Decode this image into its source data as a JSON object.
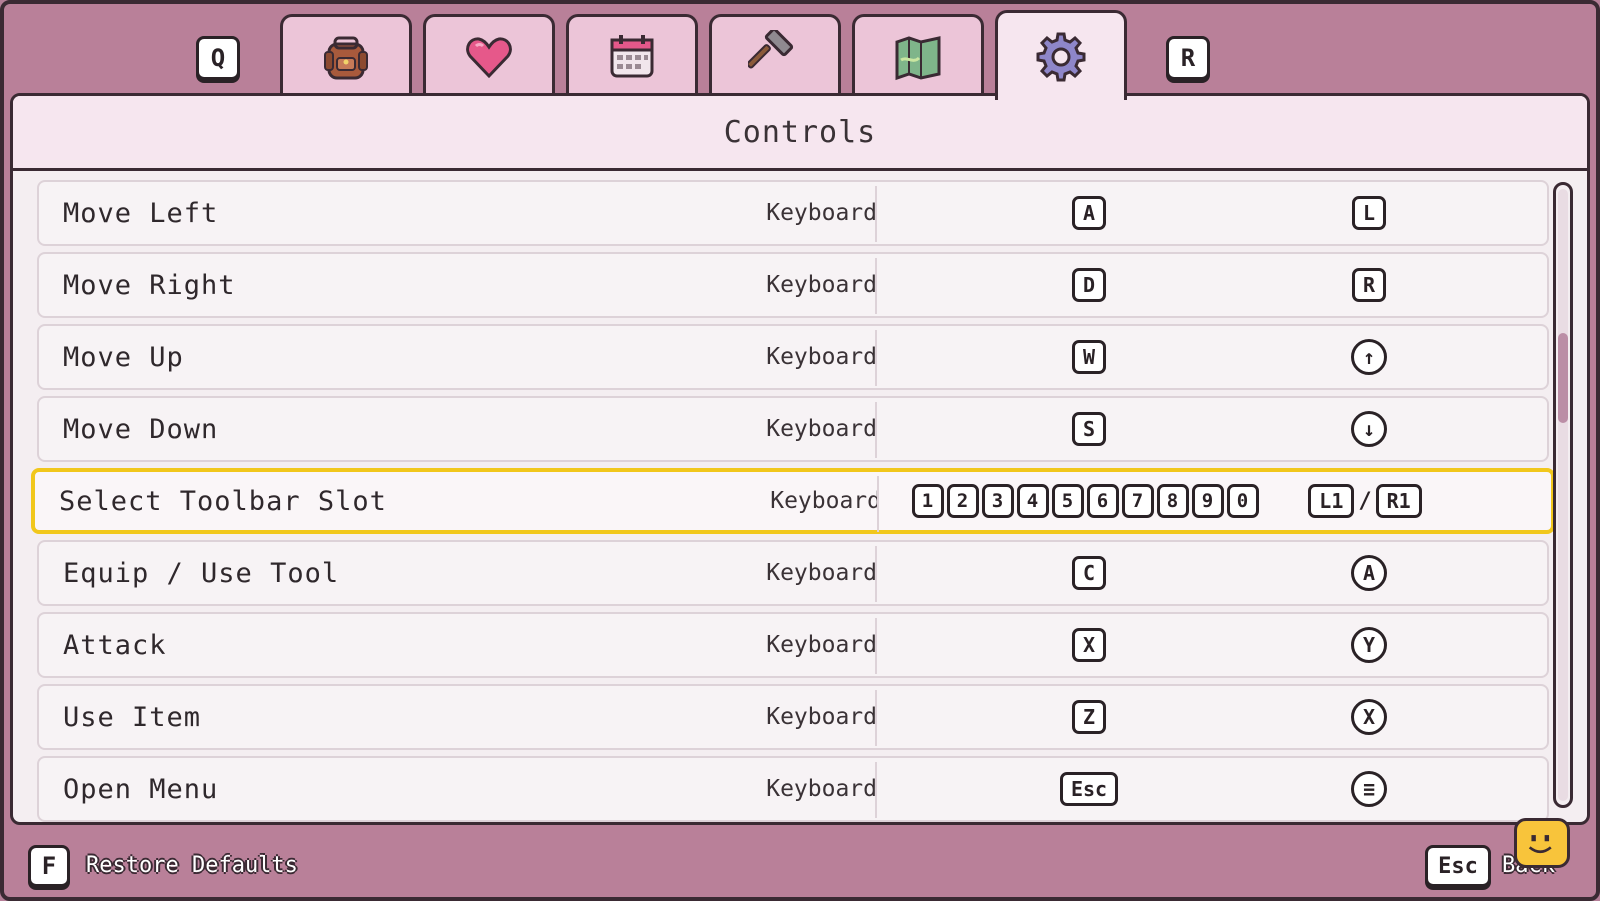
{
  "tabs": {
    "prev_key": "Q",
    "next_key": "R",
    "items": [
      {
        "icon": "backpack-icon"
      },
      {
        "icon": "heart-icon"
      },
      {
        "icon": "calendar-icon"
      },
      {
        "icon": "hammer-icon"
      },
      {
        "icon": "map-icon"
      },
      {
        "icon": "gear-icon",
        "active": true
      }
    ]
  },
  "panel": {
    "title": "Controls"
  },
  "controls": [
    {
      "action": "Move Left",
      "device": "Keyboard",
      "keys": [
        "A"
      ],
      "gamepad": [
        "L"
      ],
      "gamepad_style": "key"
    },
    {
      "action": "Move Right",
      "device": "Keyboard",
      "keys": [
        "D"
      ],
      "gamepad": [
        "R"
      ],
      "gamepad_style": "key"
    },
    {
      "action": "Move Up",
      "device": "Keyboard",
      "keys": [
        "W"
      ],
      "gamepad": [
        "↑"
      ],
      "gamepad_style": "circle"
    },
    {
      "action": "Move Down",
      "device": "Keyboard",
      "keys": [
        "S"
      ],
      "gamepad": [
        "↓"
      ],
      "gamepad_style": "circle"
    },
    {
      "action": "Select Toolbar Slot",
      "device": "Keyboard",
      "keys": [
        "1",
        "2",
        "3",
        "4",
        "5",
        "6",
        "7",
        "8",
        "9",
        "0"
      ],
      "gamepad": [
        "L1",
        "/",
        "R1"
      ],
      "gamepad_style": "key",
      "selected": true
    },
    {
      "action": "Equip / Use Tool",
      "device": "Keyboard",
      "keys": [
        "C"
      ],
      "gamepad": [
        "A"
      ],
      "gamepad_style": "circle"
    },
    {
      "action": "Attack",
      "device": "Keyboard",
      "keys": [
        "X"
      ],
      "gamepad": [
        "Y"
      ],
      "gamepad_style": "circle"
    },
    {
      "action": "Use Item",
      "device": "Keyboard",
      "keys": [
        "Z"
      ],
      "gamepad": [
        "X"
      ],
      "gamepad_style": "circle"
    },
    {
      "action": "Open Menu",
      "device": "Keyboard",
      "keys": [
        "Esc"
      ],
      "gamepad": [
        "≡"
      ],
      "gamepad_style": "circle"
    }
  ],
  "footer": {
    "restore_key": "F",
    "restore_label": "Restore Defaults",
    "back_key": "Esc",
    "back_label": "Back"
  },
  "colors": {
    "selection": "#f1c71c",
    "accent": "#b98099"
  }
}
